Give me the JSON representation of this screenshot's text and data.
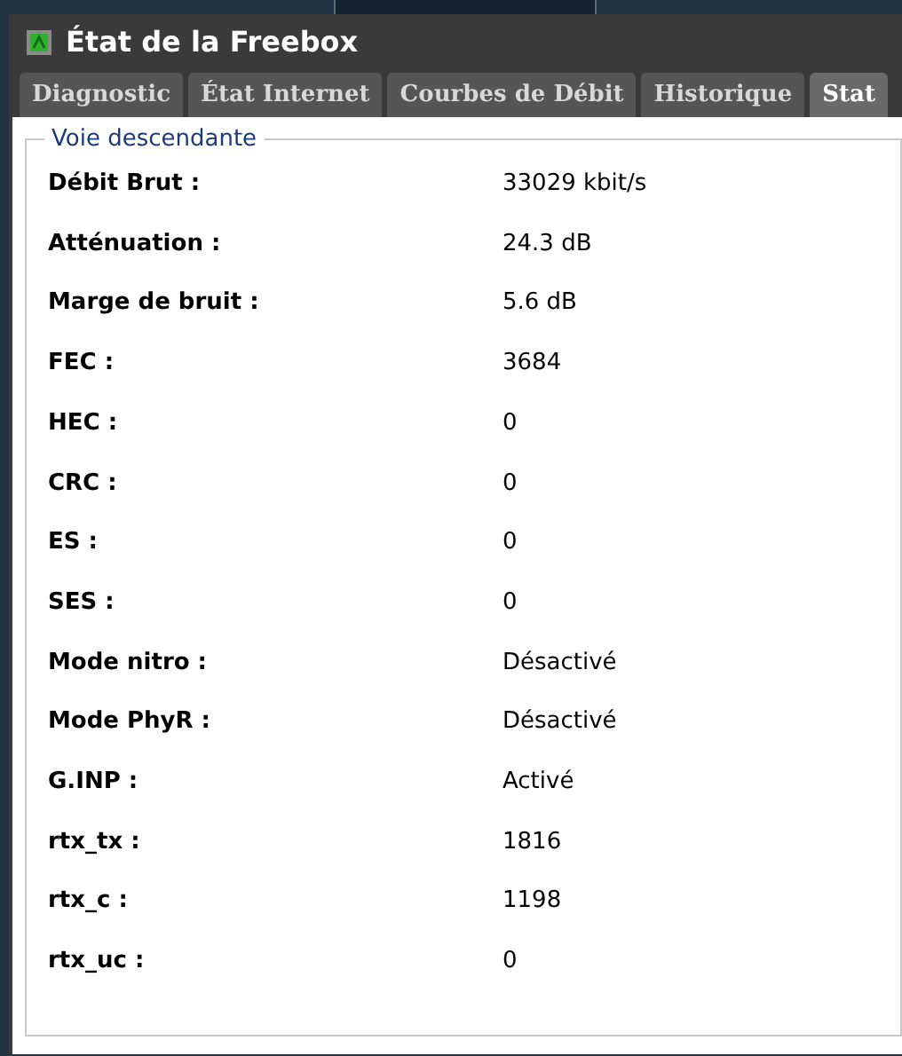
{
  "window": {
    "title": "État de la Freebox"
  },
  "tabs": [
    {
      "label": "Diagnostic",
      "selected": false
    },
    {
      "label": "État Internet",
      "selected": false
    },
    {
      "label": "Courbes de Débit",
      "selected": false
    },
    {
      "label": "Historique",
      "selected": false
    },
    {
      "label": "Stat",
      "selected": true
    }
  ],
  "section": {
    "legend": "Voie descendante",
    "rows": [
      {
        "label": "Débit Brut :",
        "value": "33029 kbit/s"
      },
      {
        "label": "Atténuation :",
        "value": "24.3 dB"
      },
      {
        "label": "Marge de bruit :",
        "value": "5.6 dB"
      },
      {
        "label": "FEC :",
        "value": "3684"
      },
      {
        "label": "HEC :",
        "value": "0"
      },
      {
        "label": "CRC :",
        "value": "0"
      },
      {
        "label": "ES :",
        "value": "0"
      },
      {
        "label": "SES :",
        "value": "0"
      },
      {
        "label": "Mode nitro :",
        "value": "Désactivé"
      },
      {
        "label": "Mode PhyR :",
        "value": "Désactivé"
      },
      {
        "label": "G.INP :",
        "value": "Activé"
      },
      {
        "label": "rtx_tx :",
        "value": "1816"
      },
      {
        "label": "rtx_c :",
        "value": "1198"
      },
      {
        "label": "rtx_uc :",
        "value": "0"
      }
    ]
  }
}
